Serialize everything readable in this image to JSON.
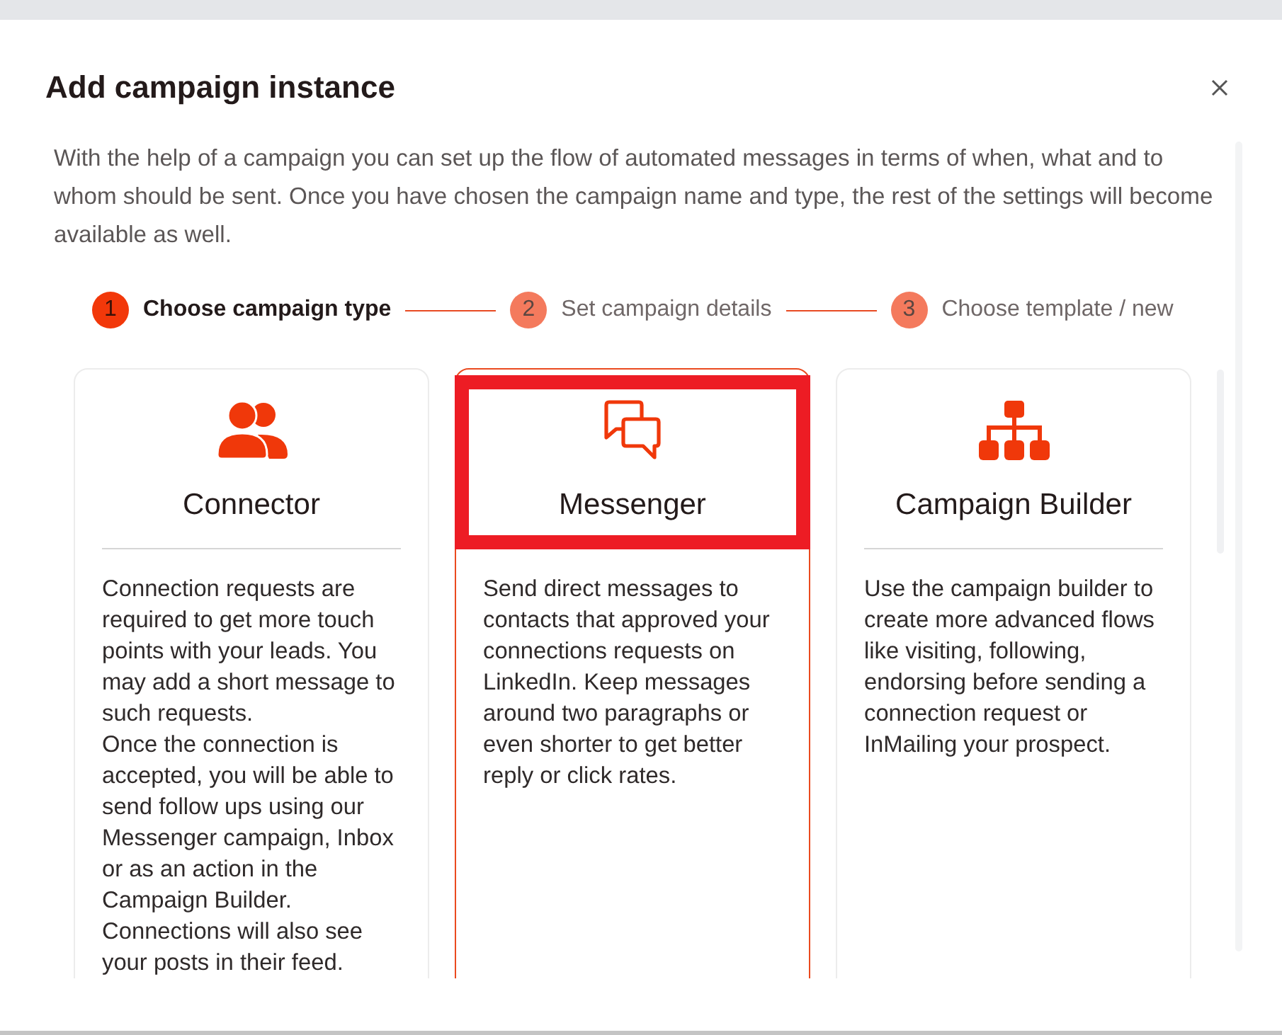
{
  "dialog": {
    "title": "Add campaign instance"
  },
  "description": "With the help of a campaign you can set up the flow of automated messages in terms of when, what and to whom should be sent. Once you have chosen the campaign name and type, the rest of the settings will become available as well.",
  "steps": [
    {
      "number": "1",
      "label": "Choose campaign type",
      "active": true
    },
    {
      "number": "2",
      "label": "Set campaign details",
      "active": false
    },
    {
      "number": "3",
      "label": "Choose template / new",
      "active": false
    }
  ],
  "campaign_types": [
    {
      "kind": "connector",
      "title": "Connector",
      "selected": false,
      "highlighted": false,
      "paragraphs": [
        "Connection requests are required to get more touch points with your leads. You may add a short message to such requests.",
        "Once the connection is accepted, you will be able to send follow ups using our Messenger campaign, Inbox or as an action in the Campaign Builder. Connections will also see your posts in their feed."
      ]
    },
    {
      "kind": "messenger",
      "title": "Messenger",
      "selected": true,
      "highlighted": true,
      "paragraphs": [
        "Send direct messages to contacts that approved your connections requests on LinkedIn. Keep messages around two paragraphs or even shorter to get better reply or click rates."
      ]
    },
    {
      "kind": "builder",
      "title": "Campaign Builder",
      "selected": false,
      "highlighted": false,
      "paragraphs": [
        "Use the campaign builder to create more advanced flows like visiting, following, endorsing before sending a connection request or InMailing your prospect."
      ]
    }
  ]
}
